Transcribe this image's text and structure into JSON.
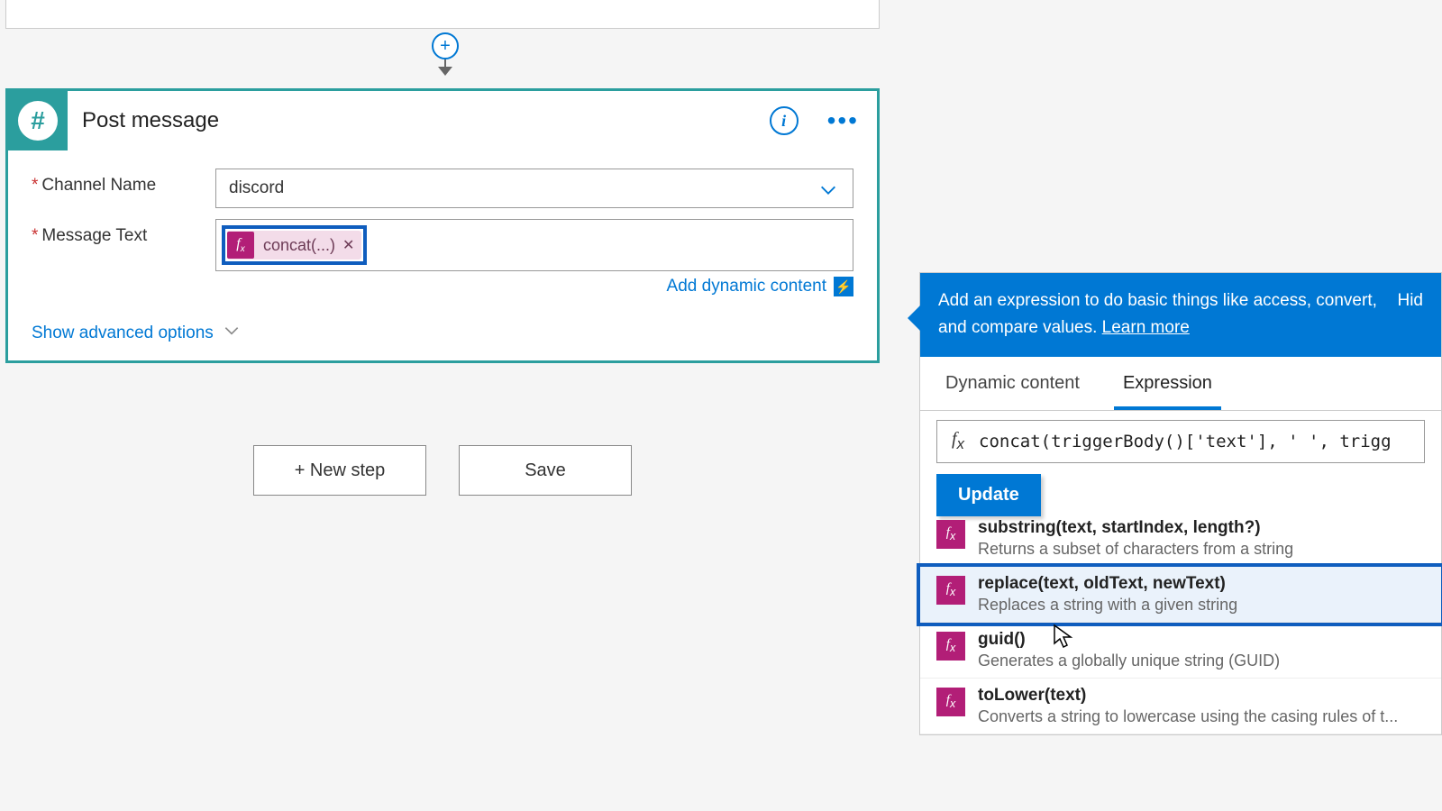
{
  "card": {
    "title": "Post message",
    "fields": {
      "channel_label": "Channel Name",
      "channel_value": "discord",
      "message_label": "Message Text",
      "token_label": "concat(...)"
    },
    "add_dynamic": "Add dynamic content",
    "advanced": "Show advanced options"
  },
  "buttons": {
    "new_step": "+ New step",
    "save": "Save"
  },
  "flyout": {
    "intro": "Add an expression to do basic things like access, convert, and compare values. ",
    "learn": "Learn more",
    "hide": "Hid",
    "tabs": {
      "dynamic": "Dynamic content",
      "expression": "Expression"
    },
    "expr_value": "concat(triggerBody()['text'], ' ', trigg",
    "update": "Update",
    "functions": [
      {
        "sig": "substring(text, startIndex, length?)",
        "desc": "Returns a subset of characters from a string",
        "partial": true
      },
      {
        "sig": "replace(text, oldText, newText)",
        "desc": "Replaces a string with a given string",
        "highlighted": true
      },
      {
        "sig": "guid()",
        "desc": "Generates a globally unique string (GUID)"
      },
      {
        "sig": "toLower(text)",
        "desc": "Converts a string to lowercase using the casing rules of t..."
      }
    ]
  }
}
